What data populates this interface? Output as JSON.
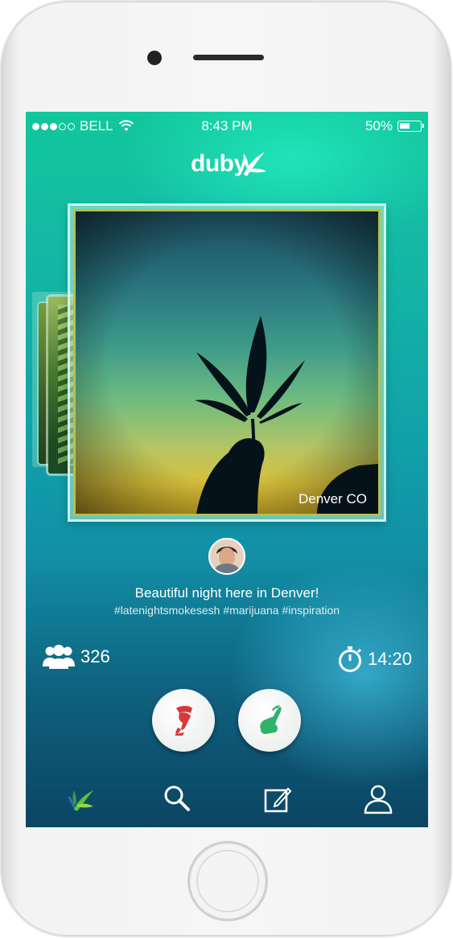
{
  "status_bar": {
    "carrier": "BELL",
    "time": "8:43 PM",
    "battery_percent": "50%",
    "battery_level": 0.5,
    "signal_filled": 3,
    "signal_total": 5
  },
  "app": {
    "logo_text": "duby"
  },
  "post": {
    "location": "Denver CO",
    "caption": "Beautiful night here in Denver!",
    "hashtags": "#latenightsmokesesh #marijuana #inspiration"
  },
  "stats": {
    "followers_count": "326",
    "time_remaining": "14:20"
  },
  "actions": {
    "pass_icon": "thumbs-down-hand-icon",
    "like_icon": "thumbs-up-hand-icon"
  },
  "tab_bar": {
    "items": [
      {
        "icon": "duby-leaf-icon"
      },
      {
        "icon": "search-icon"
      },
      {
        "icon": "compose-icon"
      },
      {
        "icon": "profile-icon"
      }
    ]
  },
  "colors": {
    "accent_green": "#2fb36a",
    "accent_red": "#d63a3a",
    "screen_top": "#12c79c",
    "screen_bottom": "#0b4563"
  }
}
